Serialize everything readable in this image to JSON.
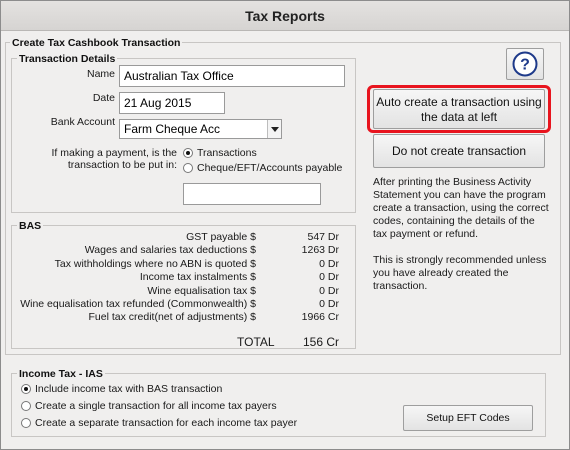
{
  "window": {
    "title": "Tax Reports"
  },
  "create_section": {
    "legend": "Create Tax Cashbook Transaction",
    "transaction_details": {
      "legend": "Transaction Details",
      "name_label": "Name",
      "name_value": "Australian Tax Office",
      "date_label": "Date",
      "date_value": "21 Aug 2015",
      "bank_label": "Bank Account",
      "bank_value": "Farm Cheque Acc",
      "payment_label_line1": "If making a payment, is the",
      "payment_label_line2": "transaction to be put in:",
      "option_transactions": "Transactions",
      "option_cheque": "Cheque/EFT/Accounts payable",
      "selected_option": "Transactions",
      "cheque_number_value": ""
    },
    "bas": {
      "legend": "BAS",
      "rows": [
        {
          "label": "GST payable $",
          "value": "547 Dr"
        },
        {
          "label": "Wages and salaries tax deductions $",
          "value": "1263 Dr"
        },
        {
          "label": "Tax withholdings where no ABN is quoted $",
          "value": "0 Dr"
        },
        {
          "label": "Income tax instalments $",
          "value": "0 Dr"
        },
        {
          "label": "Wine equalisation tax $",
          "value": "0 Dr"
        },
        {
          "label": "Wine equalisation tax refunded (Commonwealth) $",
          "value": "0 Dr"
        },
        {
          "label": "Fuel tax credit(net of adjustments) $",
          "value": "1966 Cr"
        }
      ],
      "total_label": "TOTAL",
      "total_value": "156 Cr"
    }
  },
  "actions": {
    "help_icon": "question-mark-icon",
    "auto_create_line1": "Auto create a transaction using",
    "auto_create_line2": "the data at left",
    "do_not_create": "Do not create transaction",
    "highlight_color": "#e8141e",
    "info_para1": "After printing the Business Activity Statement you can have the program create a transaction, using the correct codes, containing the details of the tax payment or refund.",
    "info_para2": "This is strongly recommended unless you have already created the transaction."
  },
  "income_tax": {
    "legend": "Income Tax - IAS",
    "options": [
      "Include income tax with BAS transaction",
      "Create a single transaction for all income tax payers",
      "Create a separate transaction for each income tax payer"
    ],
    "selected_index": 0,
    "setup_eft_button": "Setup EFT Codes"
  }
}
